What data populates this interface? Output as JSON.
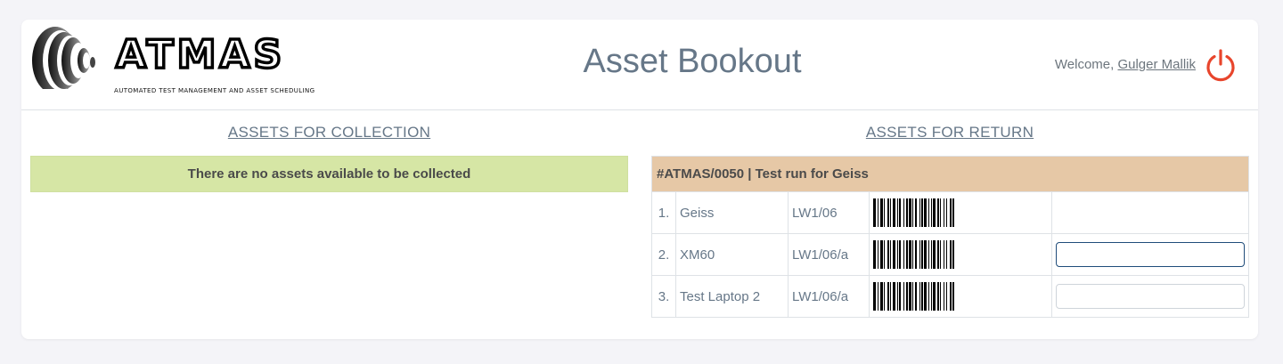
{
  "brand": {
    "name": "ATMAS",
    "tagline": "AUTOMATED TEST MANAGEMENT AND ASSET SCHEDULING"
  },
  "header": {
    "title": "Asset Bookout",
    "welcome_prefix": "Welcome, ",
    "user_name": "Gulger Mallik",
    "power_icon": "power-icon",
    "power_color": "#e8452c"
  },
  "collection": {
    "title": "ASSETS FOR COLLECTION",
    "empty_message": "There are no assets available to be collected",
    "empty_bg": "#d6e6a5"
  },
  "returns": {
    "title": "ASSETS FOR RETURN",
    "group_header": "#ATMAS/0050 | Test run for Geiss",
    "group_bg": "#e6c8a6",
    "items": [
      {
        "num": "1.",
        "name": "Geiss",
        "location": "LW1/06",
        "has_input": false,
        "input_value": ""
      },
      {
        "num": "2.",
        "name": "XM60",
        "location": "LW1/06/a",
        "has_input": true,
        "input_value": ""
      },
      {
        "num": "3.",
        "name": "Test Laptop 2",
        "location": "LW1/06/a",
        "has_input": true,
        "input_value": ""
      }
    ]
  }
}
